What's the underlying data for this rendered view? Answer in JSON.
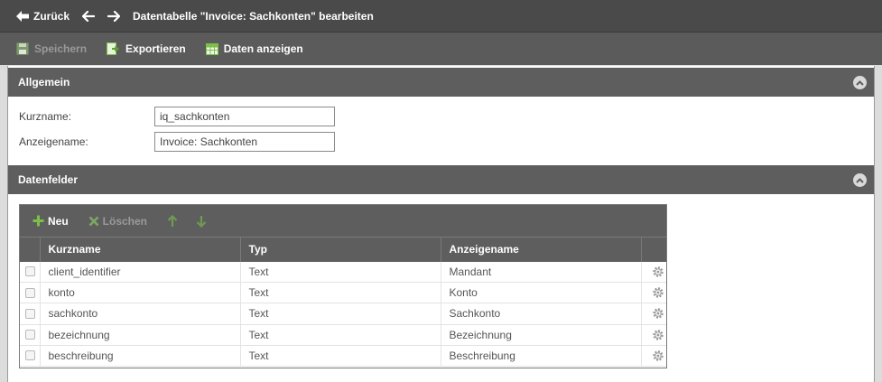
{
  "header": {
    "back_label": "Zurück",
    "title": "Datentabelle \"Invoice: Sachkonten\" bearbeiten"
  },
  "toolbar": {
    "save_label": "Speichern",
    "export_label": "Exportieren",
    "show_data_label": "Daten anzeigen"
  },
  "general": {
    "title": "Allgemein",
    "short_name_label": "Kurzname:",
    "short_name_value": "iq_sachkonten",
    "display_name_label": "Anzeigename:",
    "display_name_value": "Invoice: Sachkonten"
  },
  "fields": {
    "title": "Datenfelder",
    "new_label": "Neu",
    "delete_label": "Löschen",
    "columns": [
      "Kurzname",
      "Typ",
      "Anzeigename"
    ],
    "rows": [
      {
        "name": "client_identifier",
        "type": "Text",
        "display": "Mandant"
      },
      {
        "name": "konto",
        "type": "Text",
        "display": "Konto"
      },
      {
        "name": "sachkonto",
        "type": "Text",
        "display": "Sachkonto"
      },
      {
        "name": "bezeichnung",
        "type": "Text",
        "display": "Bezeichnung"
      },
      {
        "name": "beschreibung",
        "type": "Text",
        "display": "Beschreibung"
      }
    ]
  },
  "colors": {
    "header_bg": "#4a4a4a",
    "section_bg": "#5e5e5e",
    "accent_green": "#7cc04a"
  }
}
